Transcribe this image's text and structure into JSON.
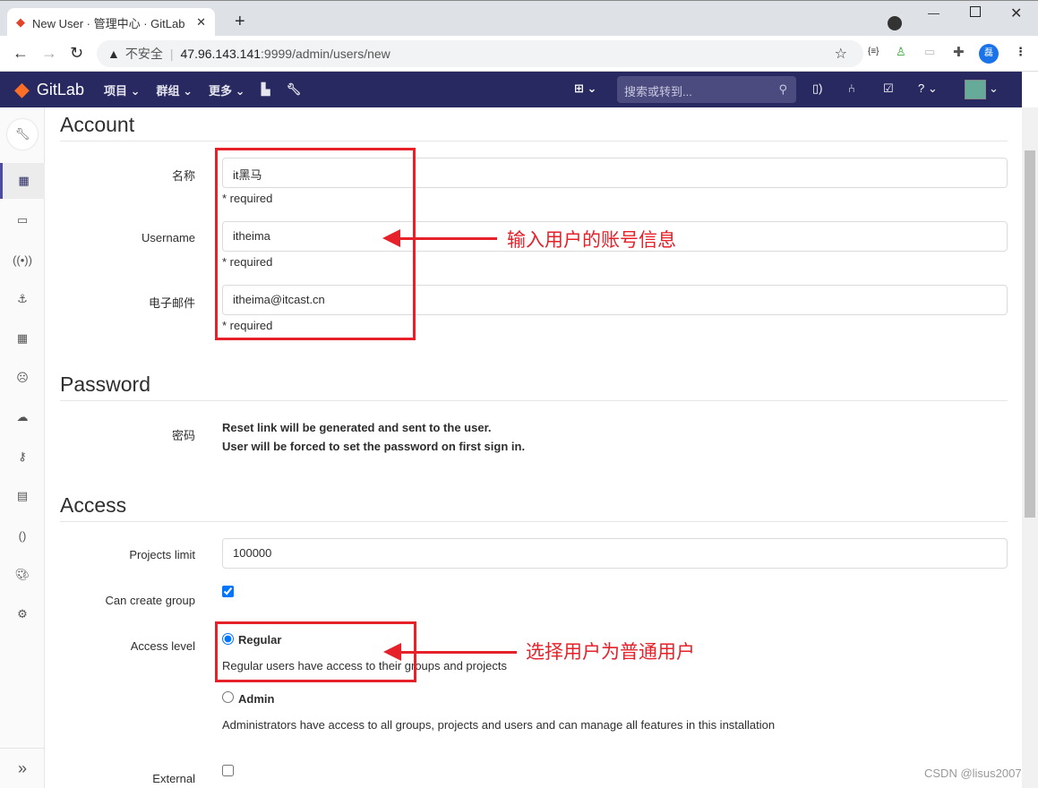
{
  "browser": {
    "tab_title": "New User · 管理中心 · GitLab",
    "insecure": "不安全",
    "url_host": "47.96.143.141",
    "url_path": ":9999/admin/users/new",
    "profile_initial": "磊"
  },
  "nav": {
    "brand": "GitLab",
    "items": [
      "项目",
      "群组",
      "更多"
    ],
    "search_placeholder": "搜索或转到..."
  },
  "account": {
    "title": "Account",
    "fields": [
      {
        "label": "名称",
        "value": "it黑马",
        "help": "* required"
      },
      {
        "label": "Username",
        "value": "itheima",
        "help": "* required"
      },
      {
        "label": "电子邮件",
        "value": "itheima@itcast.cn",
        "help": "* required"
      }
    ]
  },
  "password": {
    "title": "Password",
    "label": "密码",
    "line1": "Reset link will be generated and sent to the user.",
    "line2": "User will be forced to set the password on first sign in."
  },
  "access": {
    "title": "Access",
    "projects_limit_label": "Projects limit",
    "projects_limit": "100000",
    "can_create_group_label": "Can create group",
    "can_create_group": true,
    "access_level_label": "Access level",
    "regular": "Regular",
    "regular_help": "Regular users have access to their groups and projects",
    "admin": "Admin",
    "admin_help": "Administrators have access to all groups, projects and users and can manage all features in this installation",
    "external_label": "External",
    "selected": "Regular"
  },
  "annotations": {
    "account": "输入用户的账号信息",
    "access": "选择用户为普通用户"
  },
  "watermark": "CSDN @lisus2007",
  "colors": {
    "nav": "#292961",
    "annotation": "#e6212a",
    "accent": "#1068bf"
  }
}
